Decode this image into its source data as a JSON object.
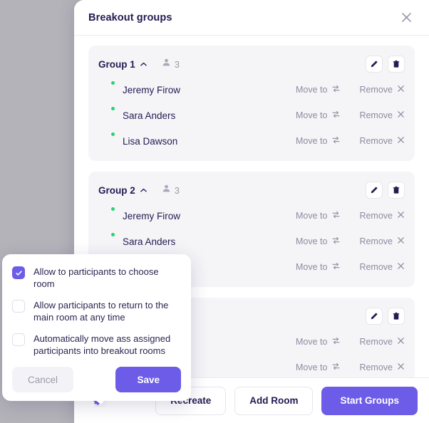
{
  "backdrop": {
    "color": "#b4b3ba"
  },
  "dialog": {
    "title": "Breakout groups",
    "close_icon": "close-icon"
  },
  "groups": [
    {
      "name": "Group 1",
      "collapse_icon": "chevron-up-icon",
      "people_icon": "person-icon",
      "count": "3",
      "edit_icon": "pencil-icon",
      "delete_icon": "trash-icon",
      "participants": [
        {
          "name": "Jeremy Firow",
          "status": "online",
          "move_label": "Move to",
          "move_icon": "swap-icon",
          "remove_label": "Remove",
          "remove_icon": "close-icon"
        },
        {
          "name": "Sara Anders",
          "status": "online",
          "move_label": "Move to",
          "move_icon": "swap-icon",
          "remove_label": "Remove",
          "remove_icon": "close-icon"
        },
        {
          "name": "Lisa Dawson",
          "status": "online",
          "move_label": "Move to",
          "move_icon": "swap-icon",
          "remove_label": "Remove",
          "remove_icon": "close-icon"
        }
      ]
    },
    {
      "name": "Group 2",
      "collapse_icon": "chevron-up-icon",
      "people_icon": "person-icon",
      "count": "3",
      "edit_icon": "pencil-icon",
      "delete_icon": "trash-icon",
      "participants": [
        {
          "name": "Jeremy Firow",
          "status": "online",
          "move_label": "Move to",
          "move_icon": "swap-icon",
          "remove_label": "Remove",
          "remove_icon": "close-icon"
        },
        {
          "name": "Sara Anders",
          "status": "online",
          "move_label": "Move to",
          "move_icon": "swap-icon",
          "remove_label": "Remove",
          "remove_icon": "close-icon"
        },
        {
          "name": "",
          "status": "online",
          "move_label": "Move to",
          "move_icon": "swap-icon",
          "remove_label": "Remove",
          "remove_icon": "close-icon"
        }
      ]
    },
    {
      "name": "",
      "collapse_icon": "chevron-up-icon",
      "people_icon": "person-icon",
      "count": "",
      "edit_icon": "pencil-icon",
      "delete_icon": "trash-icon",
      "participants": [
        {
          "name": "",
          "status": "online",
          "move_label": "Move to",
          "move_icon": "swap-icon",
          "remove_label": "Remove",
          "remove_icon": "close-icon"
        },
        {
          "name": "",
          "status": "online",
          "move_label": "Move to",
          "move_icon": "swap-icon",
          "remove_label": "Remove",
          "remove_icon": "close-icon"
        }
      ]
    }
  ],
  "footer": {
    "settings_icon": "gear-icon",
    "recreate_label": "Recreate",
    "add_room_label": "Add Room",
    "start_groups_label": "Start Groups"
  },
  "settings_popover": {
    "options": [
      {
        "label": "Allow to participants to choose room",
        "checked": true
      },
      {
        "label": "Allow participants to return to the main room at any time",
        "checked": false
      },
      {
        "label": "Automatically move ass assigned participants into breakout rooms",
        "checked": false
      }
    ],
    "cancel_label": "Cancel",
    "save_label": "Save"
  },
  "colors": {
    "accent": "#6c5ce7",
    "text": "#231b52",
    "muted": "#8d8ca0",
    "card": "#f5f5f8",
    "online": "#29d07b"
  }
}
